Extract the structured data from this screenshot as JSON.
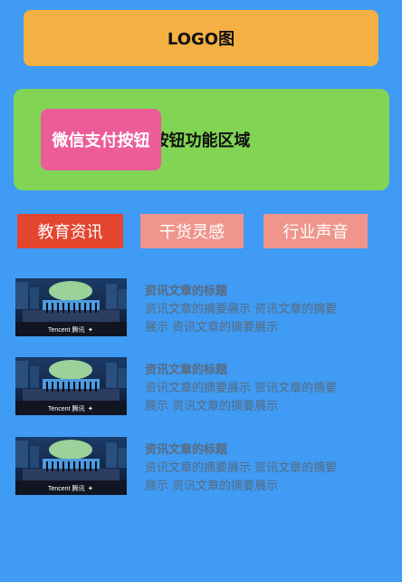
{
  "header": {
    "logo_text": "LOGO图"
  },
  "action_area": {
    "label": "按钮功能区域",
    "wechat_pay_label": "微信支付按钮",
    "background": "#82d455",
    "button_color": "#ec5d98"
  },
  "tabs": [
    {
      "label": "教育资讯",
      "active": true,
      "color": "#e3452f"
    },
    {
      "label": "干货灵感",
      "active": false,
      "color": "#ef958b"
    },
    {
      "label": "行业声音",
      "active": false,
      "color": "#ef958b"
    }
  ],
  "articles": [
    {
      "title": "资讯文章的标题",
      "summary": "资讯文章的摘要展示 资讯文章的摘要展示 资讯文章的摘要展示",
      "thumbnail_caption": "Tencent 腾讯"
    },
    {
      "title": "资讯文章的标题",
      "summary": "资讯文章的摘要展示 资讯文章的摘要展示 资讯文章的摘要展示",
      "thumbnail_caption": "Tencent 腾讯"
    },
    {
      "title": "资讯文章的标题",
      "summary": "资讯文章的摘要展示 资讯文章的摘要展示 资讯文章的摘要展示",
      "thumbnail_caption": "Tencent 腾讯"
    }
  ],
  "colors": {
    "page_background": "#3f9bf3",
    "logo_background": "#f5b043",
    "text_muted": "#5a6a7e"
  }
}
